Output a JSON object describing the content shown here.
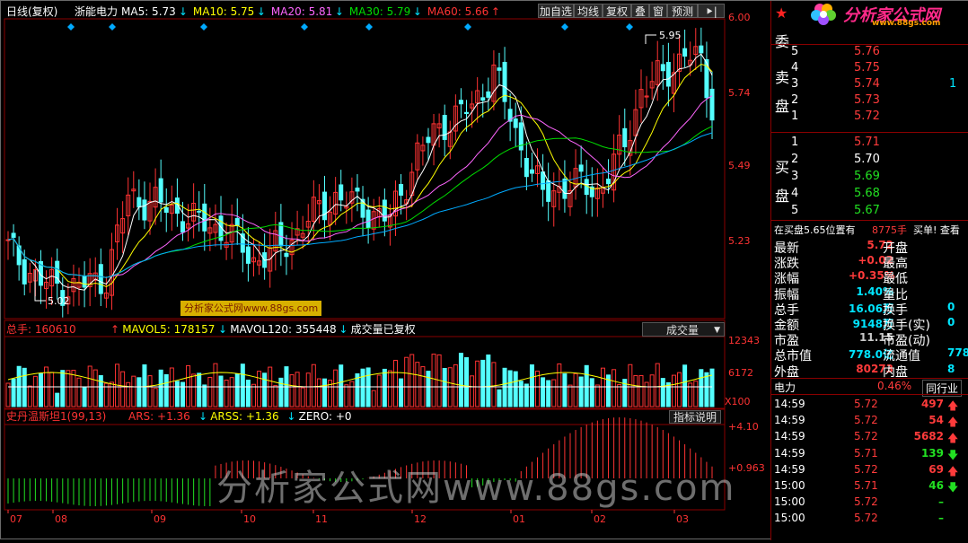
{
  "header": {
    "period_label": "日线(复权)",
    "stock_name": "浙能电力",
    "ma": [
      {
        "label": "MA5: 5.73",
        "arrow": "↓",
        "color": "#ffffff"
      },
      {
        "label": "MA10: 5.75",
        "arrow": "↓",
        "color": "#ffff00"
      },
      {
        "label": "MA20: 5.81",
        "arrow": "↓",
        "color": "#ff66ff"
      },
      {
        "label": "MA30: 5.79",
        "arrow": "↓",
        "color": "#00dd00"
      },
      {
        "label": "MA60: 5.66",
        "arrow": "↑",
        "color": "#ff3333"
      }
    ]
  },
  "toolbar": {
    "buttons": [
      "加自选",
      "均线",
      "复权",
      "叠",
      "窗",
      "预测"
    ],
    "more": "⯈|"
  },
  "price_axis": [
    "6.00",
    "5.74",
    "5.49",
    "5.23"
  ],
  "annotations": {
    "high": "5.95",
    "low": "5.02"
  },
  "watermark_small": "分析家公式网www.88gs.com",
  "volume_header": {
    "total_label": "总手: 160610",
    "total_arrow": "↑",
    "mavol5": "MAVOL5: 178157",
    "mavol5_arrow": "↓",
    "mavol120": "MAVOL120: 355448",
    "mavol120_arrow": "↓",
    "note": "成交量已复权",
    "dropdown": "成交量"
  },
  "volume_axis": [
    "12343",
    "6172",
    "X100"
  ],
  "indicator_header": {
    "name": "史丹温斯坦1(99,13)",
    "ars": "ARS: +1.36",
    "ars_arrow": "↓",
    "arss": "ARSS: +1.36",
    "arss_arrow": "↓",
    "zero": "ZERO: +0",
    "button": "指标说明"
  },
  "indicator_axis": [
    "+4.10",
    "+0.963"
  ],
  "watermark_big": "分析家公式网www.88gs.com",
  "months": [
    "07",
    "08",
    "09",
    "10",
    "11",
    "12",
    "01",
    "02",
    "03"
  ],
  "right_panel": {
    "logo_text": "分析家公式网",
    "logo_url": "www.88gs.com",
    "wei_label": "委",
    "sell_label": [
      "卖",
      "盘"
    ],
    "buy_label": [
      "买",
      "盘"
    ],
    "sell_orders": [
      {
        "level": "5",
        "price": "5.76"
      },
      {
        "level": "4",
        "price": "5.75"
      },
      {
        "level": "3",
        "price": "5.74",
        "vol": "1"
      },
      {
        "level": "2",
        "price": "5.73"
      },
      {
        "level": "1",
        "price": "5.72"
      }
    ],
    "buy_orders": [
      {
        "level": "1",
        "price": "5.71"
      },
      {
        "level": "2",
        "price": "5.70"
      },
      {
        "level": "3",
        "price": "5.69"
      },
      {
        "level": "4",
        "price": "5.68"
      },
      {
        "level": "5",
        "price": "5.67"
      }
    ],
    "notice": {
      "a": "在买盘5.65位置有",
      "b": "8775手",
      "c": "买单! 查看"
    },
    "stats": [
      {
        "l1": "最新",
        "v1": "5.72",
        "c1": "red",
        "l2": "开盘",
        "v2": ""
      },
      {
        "l1": "涨跌",
        "v1": "+0.02",
        "c1": "red",
        "l2": "最高",
        "v2": ""
      },
      {
        "l1": "涨幅",
        "v1": "+0.35%",
        "c1": "red",
        "l2": "最低",
        "v2": ""
      },
      {
        "l1": "振幅",
        "v1": "1.40%",
        "c1": "cyan",
        "l2": "量比",
        "v2": ""
      },
      {
        "l1": "总手",
        "v1": "16.06万",
        "c1": "cyan",
        "l2": "换手",
        "v2": "0"
      },
      {
        "l1": "金额",
        "v1": "9148万",
        "c1": "cyan",
        "l2": "换手(实)",
        "v2": "0"
      },
      {
        "l1": "市盈",
        "v1": "11.15",
        "c1": "gray",
        "l2": "市盈(动)",
        "v2": ""
      },
      {
        "l1": "总市值",
        "v1": "778.0亿",
        "c1": "cyan",
        "l2": "流通值",
        "v2": "778"
      },
      {
        "l1": "外盘",
        "v1": "80273",
        "c1": "red",
        "l2": "内盘",
        "v2": "8"
      }
    ],
    "sector": {
      "name": "电力",
      "pct": "0.46%",
      "rank": "同行业"
    },
    "ticks": [
      {
        "time": "14:59",
        "price": "5.72",
        "vol": "497",
        "dir": "up"
      },
      {
        "time": "14:59",
        "price": "5.72",
        "vol": "54",
        "dir": "up"
      },
      {
        "time": "14:59",
        "price": "5.72",
        "vol": "5682",
        "dir": "up"
      },
      {
        "time": "14:59",
        "price": "5.71",
        "vol": "139",
        "dir": "down"
      },
      {
        "time": "14:59",
        "price": "5.72",
        "vol": "69",
        "dir": "up"
      },
      {
        "time": "15:00",
        "price": "5.71",
        "vol": "46",
        "dir": "down"
      },
      {
        "time": "15:00",
        "price": "5.72",
        "vol": "–",
        "dir": "none"
      },
      {
        "time": "15:00",
        "price": "5.72",
        "vol": "–",
        "dir": "none"
      }
    ]
  },
  "colors": {
    "up": "#ff3333",
    "down": "#54ffff",
    "grid": "#8a0000",
    "green": "#22e022"
  }
}
